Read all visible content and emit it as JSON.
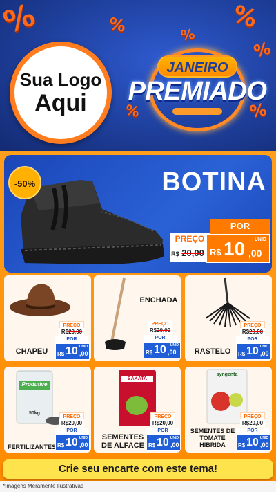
{
  "header": {
    "percent_symbol": "%",
    "logo_line1": "Sua Logo",
    "logo_line2": "Aqui",
    "badge_top": "JANEIRO",
    "badge_main": "PREMIADO"
  },
  "hero": {
    "title": "BOTINA",
    "discount": "-50%",
    "preco_label": "PREÇO",
    "old_currency": "R$",
    "old_price": "20,00",
    "por_label": "POR",
    "new_currency": "R$",
    "new_integer": "10",
    "new_cents": ",00",
    "unit": "UNID"
  },
  "products": [
    {
      "name": "CHAPEU",
      "preco_label": "PREÇO",
      "old_currency": "R$",
      "old_price": "20,00",
      "por_label": "POR",
      "currency": "R$",
      "integer": "10",
      "cents": ",00",
      "unit": "UNID"
    },
    {
      "name": "ENCHADA",
      "preco_label": "PREÇO",
      "old_currency": "R$",
      "old_price": "20,00",
      "por_label": "POR",
      "currency": "R$",
      "integer": "10",
      "cents": ",00",
      "unit": "UNID"
    },
    {
      "name": "RASTELO",
      "preco_label": "PREÇO",
      "old_currency": "R$",
      "old_price": "20,00",
      "por_label": "POR",
      "currency": "R$",
      "integer": "10",
      "cents": ",00",
      "unit": "UNID"
    },
    {
      "name": "FERTILIZANTES",
      "preco_label": "PREÇO",
      "old_currency": "R$",
      "old_price": "20,00",
      "por_label": "POR",
      "currency": "R$",
      "integer": "10",
      "cents": ",00",
      "unit": "UNID",
      "package_label": "Produtive",
      "package_weight": "50kg"
    },
    {
      "name_line1": "SEMENTES",
      "name_line2": "DE ALFACE",
      "preco_label": "PREÇO",
      "old_currency": "R$",
      "old_price": "20,00",
      "por_label": "POR",
      "currency": "R$",
      "integer": "10",
      "cents": ",00",
      "unit": "UNID",
      "package_label": "SAKATA"
    },
    {
      "name_line1": "SEMENTES DE",
      "name_line2": "TOMATE",
      "name_line3": "HIBRIDA",
      "preco_label": "PREÇO",
      "old_currency": "R$",
      "old_price": "20,00",
      "por_label": "POR",
      "currency": "R$",
      "integer": "10",
      "cents": ",00",
      "unit": "UNID",
      "package_label": "syngenta"
    }
  ],
  "cta": "Crie seu encarte com este tema!",
  "footer": "*Imagens Meramente Ilustrativas",
  "colors": {
    "blue": "#1d3f9a",
    "orange": "#ff8a00",
    "yellow": "#ffe34d",
    "price_blue": "#1f5ed6"
  }
}
